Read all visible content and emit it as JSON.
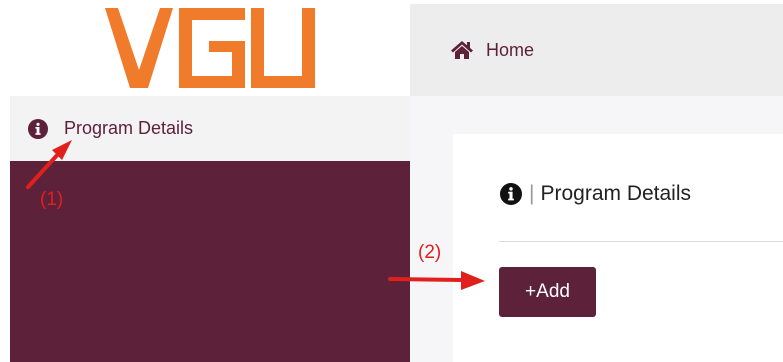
{
  "logo": {
    "text": "VGU",
    "color": "#ef7b2b"
  },
  "sidebar": {
    "items": [
      {
        "label": "Program Details",
        "icon": "info-circle-icon"
      }
    ],
    "background": "#5d2139"
  },
  "header": {
    "home_label": "Home",
    "icon": "home-icon"
  },
  "main": {
    "title": "Program Details",
    "separator": "|",
    "add_button_label": "+Add"
  },
  "annotations": {
    "label_1": "(1)",
    "label_2": "(2)",
    "color": "#e0201c"
  }
}
